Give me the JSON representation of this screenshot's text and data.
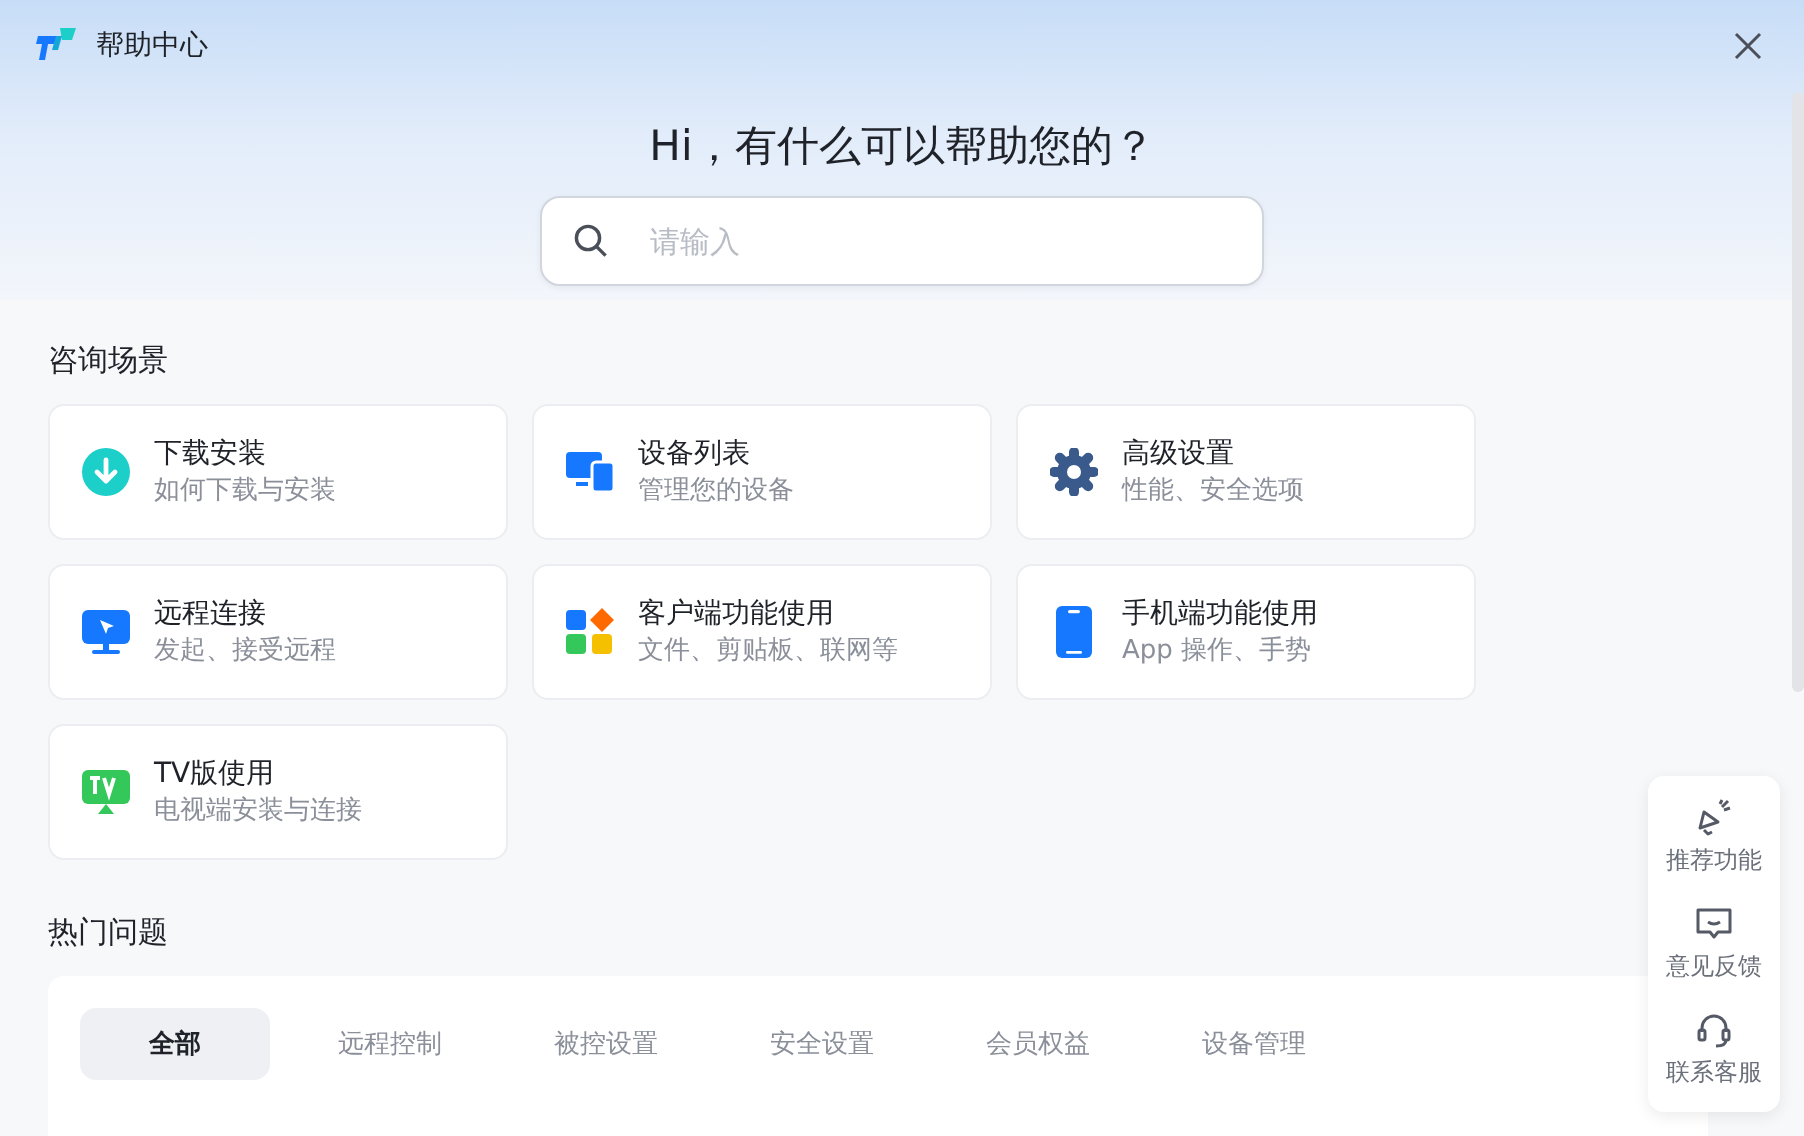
{
  "window": {
    "title": "帮助中心"
  },
  "hero": {
    "greeting": "Hi，有什么可以帮助您的？",
    "search": {
      "placeholder": "请输入"
    }
  },
  "scenes": {
    "title": "咨询场景",
    "cards": [
      {
        "kind": "download",
        "title": "下载安装",
        "subtitle": "如何下载与安装"
      },
      {
        "kind": "devices",
        "title": "设备列表",
        "subtitle": "管理您的设备"
      },
      {
        "kind": "gear",
        "title": "高级设置",
        "subtitle": "性能、安全选项"
      },
      {
        "kind": "monitor",
        "title": "远程连接",
        "subtitle": "发起、接受远程"
      },
      {
        "kind": "apps",
        "title": "客户端功能使用",
        "subtitle": "文件、剪贴板、联网等"
      },
      {
        "kind": "phone",
        "title": "手机端功能使用",
        "subtitle": "App 操作、手势"
      },
      {
        "kind": "tv",
        "title": "TV版使用",
        "subtitle": "电视端安装与连接"
      }
    ]
  },
  "faq": {
    "title": "热门问题",
    "tabs": [
      {
        "label": "全部",
        "selected": true
      },
      {
        "label": "远程控制",
        "selected": false
      },
      {
        "label": "被控设置",
        "selected": false
      },
      {
        "label": "安全设置",
        "selected": false
      },
      {
        "label": "会员权益",
        "selected": false
      },
      {
        "label": "设备管理",
        "selected": false
      }
    ]
  },
  "float_bar": [
    {
      "kind": "recommend",
      "label": "推荐功能"
    },
    {
      "kind": "feedback",
      "label": "意见反馈"
    },
    {
      "kind": "service",
      "label": "联系客服"
    }
  ]
}
